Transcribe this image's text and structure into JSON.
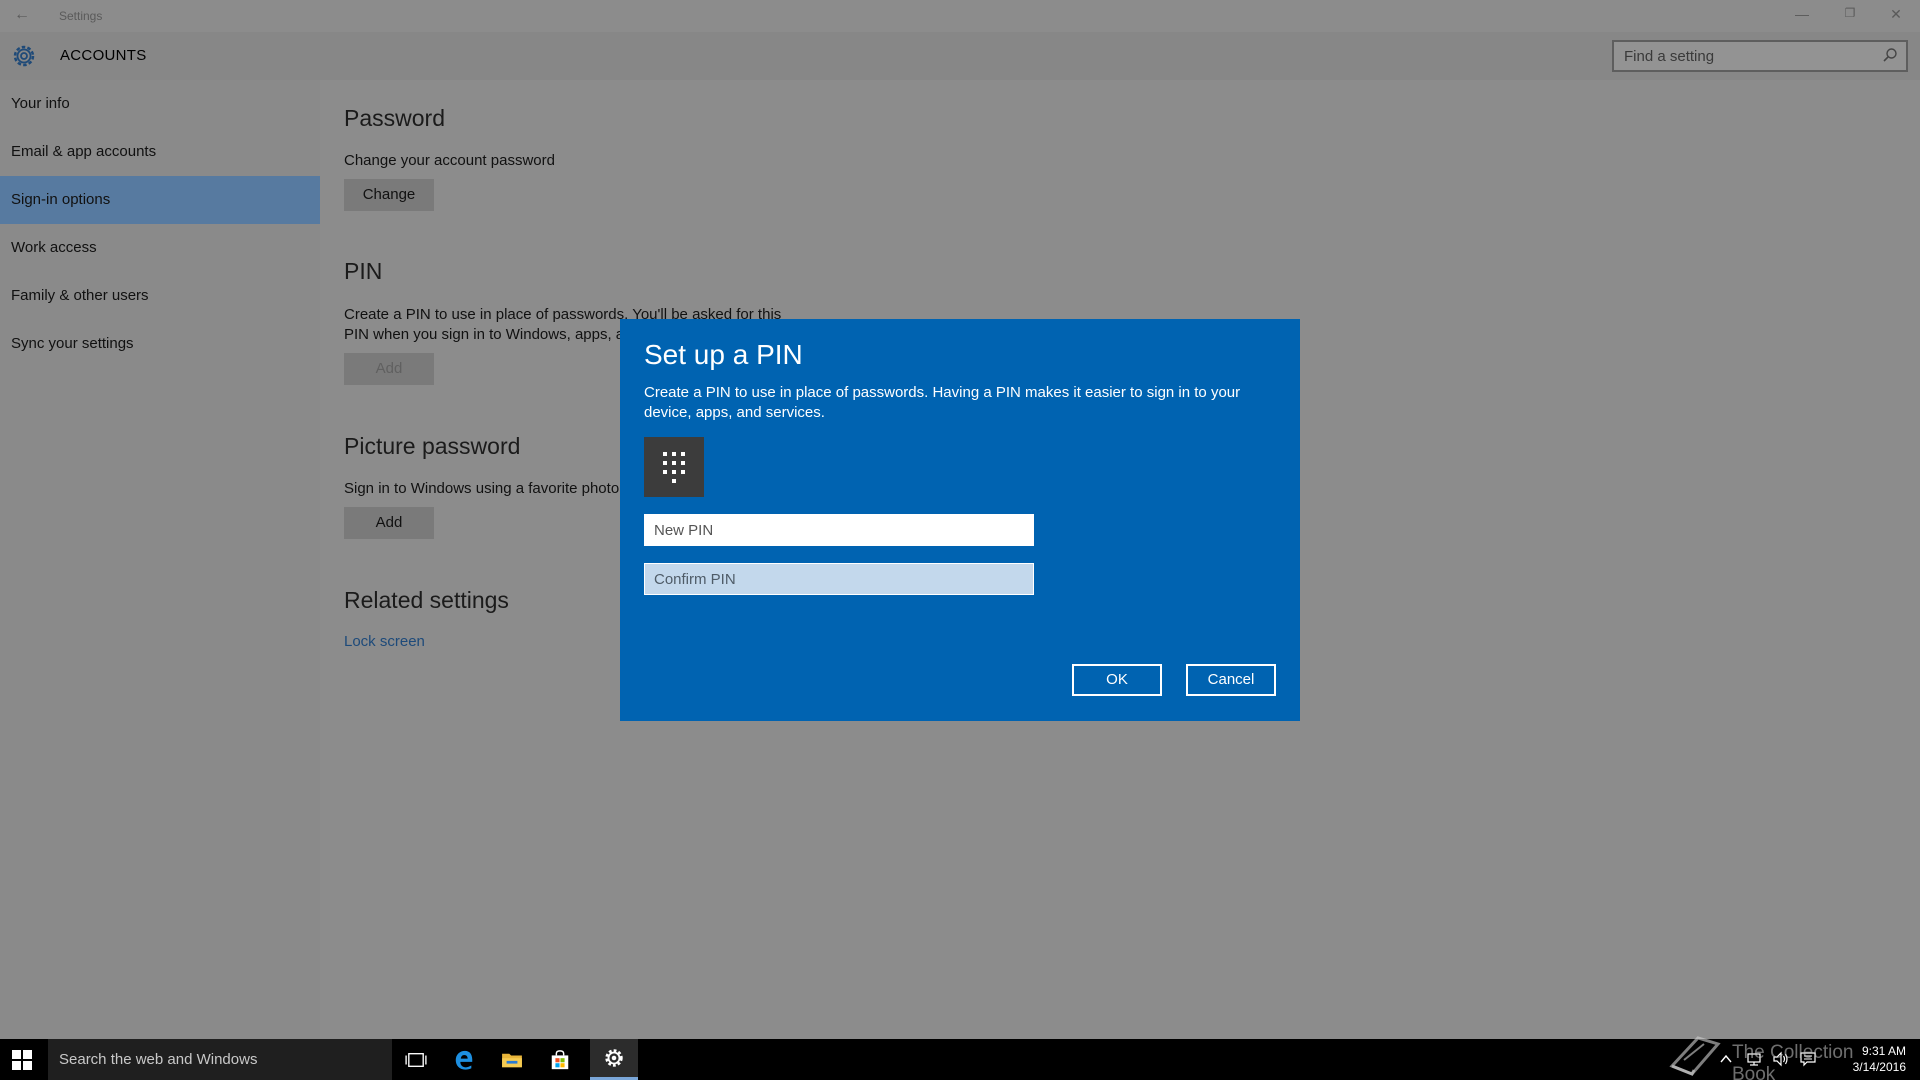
{
  "titlebar": {
    "title": "Settings",
    "back": "←",
    "minimize": "—",
    "restore": "❐",
    "close": "✕"
  },
  "header": {
    "section": "ACCOUNTS",
    "search_placeholder": "Find a setting"
  },
  "sidebar": {
    "items": [
      {
        "label": "Your info"
      },
      {
        "label": "Email & app accounts"
      },
      {
        "label": "Sign-in options",
        "active": true
      },
      {
        "label": "Work access"
      },
      {
        "label": "Family & other users"
      },
      {
        "label": "Sync your settings"
      }
    ]
  },
  "content": {
    "password": {
      "heading": "Password",
      "desc": "Change your account password",
      "button": "Change"
    },
    "pin": {
      "heading": "PIN",
      "desc_line1": "Create a PIN to use in place of passwords. You'll be asked for this",
      "desc_line2": "PIN when you sign in to Windows, apps, a",
      "button": "Add"
    },
    "picture_password": {
      "heading": "Picture password",
      "desc": "Sign in to Windows using a favorite photo",
      "button": "Add"
    },
    "related": {
      "heading": "Related settings",
      "link": "Lock screen"
    }
  },
  "dialog": {
    "title": "Set up a PIN",
    "text": "Create a PIN to use in place of passwords. Having a PIN makes it easier to sign in to your device, apps, and services.",
    "new_pin_placeholder": "New PIN",
    "confirm_pin_placeholder": "Confirm PIN",
    "ok": "OK",
    "cancel": "Cancel"
  },
  "taskbar": {
    "search_text": "Search the web and Windows",
    "time": "9:31 AM",
    "date": "3/14/2016"
  },
  "watermark": {
    "text": "The Collection Book"
  },
  "colors": {
    "dialog_bg": "#0063b1",
    "active_nav": "#577aa0",
    "dim_bg": "#8c8c8c"
  }
}
